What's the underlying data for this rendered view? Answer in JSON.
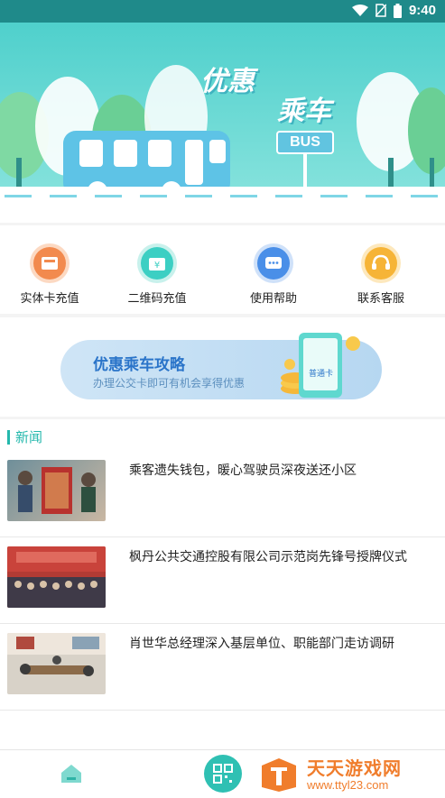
{
  "status_bar": {
    "time": "9:40"
  },
  "banner": {
    "title_line1": "优惠",
    "title_line2": "乘车",
    "bus_sign": "BUS"
  },
  "quick_actions": [
    {
      "label": "实体卡充值",
      "icon": "card-recharge-icon",
      "color": "#f28a4e"
    },
    {
      "label": "二维码充值",
      "icon": "wallet-icon",
      "color": "#3ccfc3"
    },
    {
      "label": "使用帮助",
      "icon": "chat-help-icon",
      "color": "#4a8fe8"
    },
    {
      "label": "联系客服",
      "icon": "headset-icon",
      "color": "#f6b437"
    }
  ],
  "promo": {
    "title": "优惠乘车攻略",
    "subtitle": "办理公交卡即可有机会享得优惠",
    "card_label": "普通卡"
  },
  "news": {
    "section_title": "新闻",
    "items": [
      {
        "title": "乘客遗失钱包，暖心驾驶员深夜送还小区"
      },
      {
        "title": "枫丹公共交通控股有限公司示范岗先锋号授牌仪式"
      },
      {
        "title": "肖世华总经理深入基层单位、职能部门走访调研"
      }
    ]
  },
  "watermark": {
    "name": "天天游戏网",
    "url": "www.ttyl23.com"
  }
}
